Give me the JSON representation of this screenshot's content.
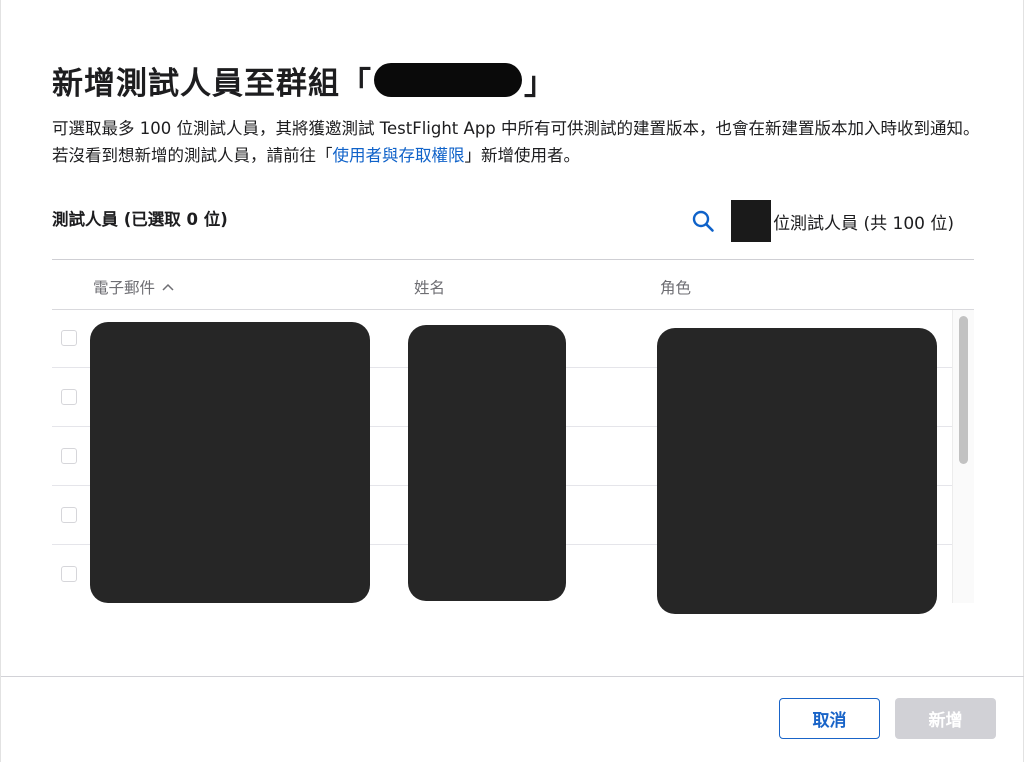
{
  "dialog": {
    "title_prefix": "新增測試人員至群組「",
    "title_suffix": "」",
    "description_part1": "可選取最多 100 位測試人員，其將獲邀測試 TestFlight App 中所有可供測試的建置版本，也會在新建置版本加入時收到通知。若沒看到想新增的測試人員，請前往「",
    "description_link": "使用者與存取權限",
    "description_part2": "」新增使用者。",
    "link_color": "#0f62c9"
  },
  "testers": {
    "header": "測試人員 (已選取 0 位)",
    "search_icon": "magnifying-glass-icon",
    "count_label": "位測試人員 (共 100 位)"
  },
  "table": {
    "columns": [
      {
        "label": "電子郵件",
        "sorted": "ascending"
      },
      {
        "label": "姓名"
      },
      {
        "label": "角色"
      }
    ],
    "visible_rows": 5
  },
  "footer": {
    "cancel_label": "取消",
    "add_label": "新增",
    "accent_color": "#1964c8",
    "disabled_color": "#d1d1d6"
  }
}
